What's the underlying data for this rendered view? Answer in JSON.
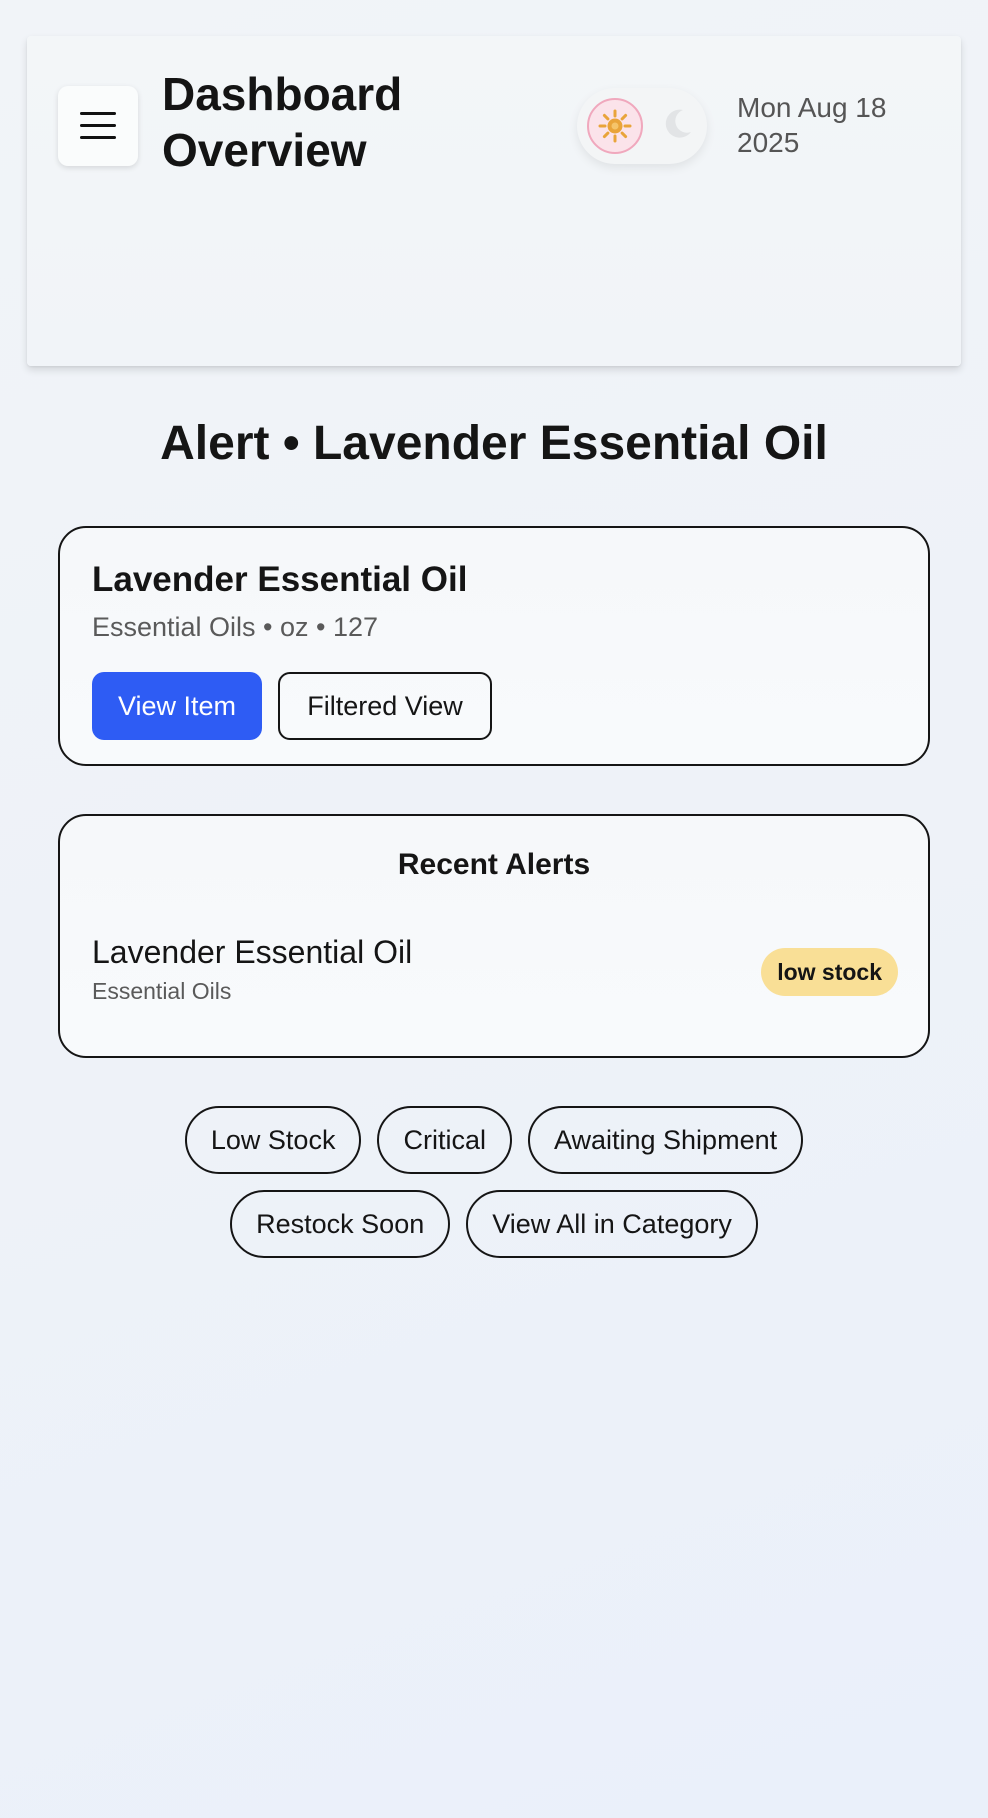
{
  "header": {
    "title": "Dashboard Overview",
    "date": "Mon Aug 18 2025",
    "menu_icon": "hamburger-menu-icon",
    "theme_toggle": {
      "light_icon": "sun-icon",
      "dark_icon": "moon-icon",
      "active": "light"
    }
  },
  "main": {
    "title": "Alert • Lavender Essential Oil"
  },
  "item_card": {
    "name": "Lavender Essential Oil",
    "meta": "Essential Oils • oz • 127",
    "view_item_label": "View Item",
    "filtered_view_label": "Filtered View"
  },
  "recent_alerts": {
    "heading": "Recent Alerts",
    "items": [
      {
        "name": "Lavender Essential Oil",
        "category": "Essential Oils",
        "badge": "low stock"
      }
    ]
  },
  "chips": {
    "row1": [
      "Low Stock",
      "Critical",
      "Awaiting Shipment"
    ],
    "row2": [
      "Restock Soon",
      "View All in Category"
    ]
  },
  "colors": {
    "primary_button": "#2e5cf4",
    "badge_low_stock": "#f9df96",
    "sun_knob_bg": "#fbe3ea",
    "sun_color": "#e9a43a"
  }
}
